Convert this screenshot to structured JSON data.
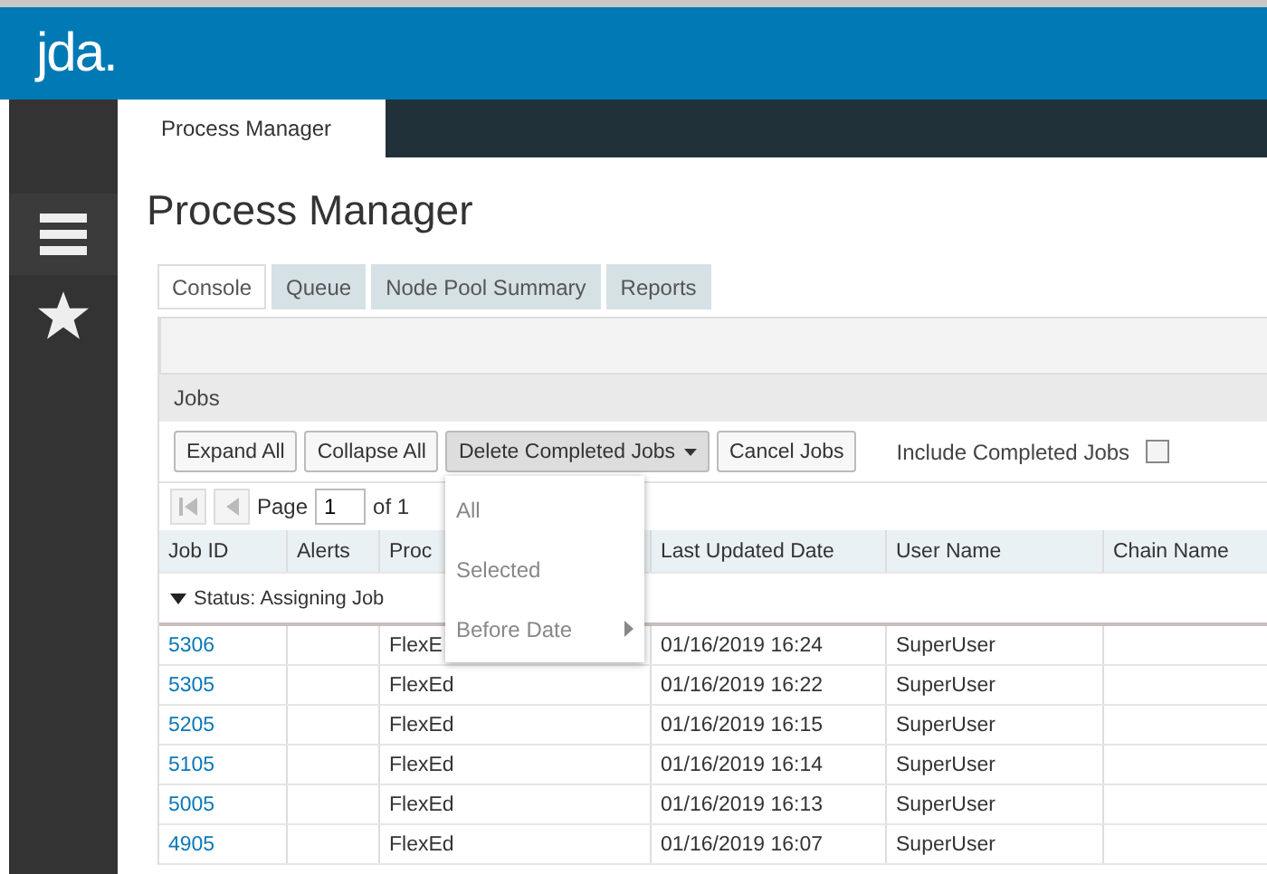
{
  "brand": {
    "logo": "jda."
  },
  "sidebar": {
    "items": [
      {
        "kind": "menu"
      },
      {
        "kind": "star"
      }
    ]
  },
  "app_tabs": [
    {
      "label": "Process Manager",
      "selected": true
    }
  ],
  "page_title": "Process Manager",
  "tabs": [
    {
      "label": "Console",
      "selected": true
    },
    {
      "label": "Queue",
      "selected": false
    },
    {
      "label": "Node Pool Summary",
      "selected": false
    },
    {
      "label": "Reports",
      "selected": false
    }
  ],
  "jobs_panel": {
    "title": "Jobs",
    "buttons": [
      {
        "label": "Expand All",
        "kind": "plain"
      },
      {
        "label": "Collapse All",
        "kind": "plain"
      },
      {
        "label": "Delete Completed Jobs",
        "kind": "dropdown",
        "expanded": true
      },
      {
        "label": "Cancel Jobs",
        "kind": "plain"
      }
    ],
    "include_completed": {
      "label": "Include Completed Jobs",
      "checked": false
    },
    "pager": {
      "label": "Page",
      "value": "1",
      "of": "of 1"
    },
    "dropdown_menu": [
      {
        "label": "All",
        "submenu": false
      },
      {
        "label": "Selected",
        "submenu": false
      },
      {
        "label": "Before Date",
        "submenu": true
      }
    ],
    "columns": [
      "Job ID",
      "Alerts",
      "Proc",
      "Last Updated Date",
      "User Name",
      "Chain Name"
    ],
    "group": {
      "label": "Status: Assigning Job",
      "expanded": true
    },
    "rows": [
      {
        "job_id": "5306",
        "process": "FlexE",
        "updated": "01/16/2019 16:24",
        "user": "SuperUser"
      },
      {
        "job_id": "5305",
        "process": "FlexEd",
        "updated": "01/16/2019 16:22",
        "user": "SuperUser"
      },
      {
        "job_id": "5205",
        "process": "FlexEd",
        "updated": "01/16/2019 16:15",
        "user": "SuperUser"
      },
      {
        "job_id": "5105",
        "process": "FlexEd",
        "updated": "01/16/2019 16:14",
        "user": "SuperUser"
      },
      {
        "job_id": "5005",
        "process": "FlexEd",
        "updated": "01/16/2019 16:13",
        "user": "SuperUser"
      },
      {
        "job_id": "4905",
        "process": "FlexEd",
        "updated": "01/16/2019 16:07",
        "user": "SuperUser"
      }
    ]
  }
}
